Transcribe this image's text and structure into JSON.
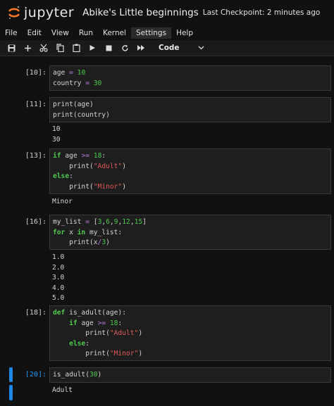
{
  "header": {
    "logo_text": "jupyter",
    "notebook_title": "Abike's Little beginnings",
    "checkpoint": "Last Checkpoint: 2 minutes ago"
  },
  "menu": [
    "File",
    "Edit",
    "View",
    "Run",
    "Kernel",
    "Settings",
    "Help"
  ],
  "toolbar": {
    "buttons": [
      "save-icon",
      "add-cell-icon",
      "cut-icon",
      "copy-icon",
      "paste-icon",
      "run-icon",
      "stop-icon",
      "restart-icon",
      "fast-forward-icon"
    ],
    "cell_type": "Code"
  },
  "cells": [
    {
      "prompt": "[10]:",
      "lines": [
        [
          [
            "age ",
            ""
          ],
          [
            "=",
            "op"
          ],
          [
            " ",
            ""
          ],
          [
            "10",
            "num"
          ]
        ],
        [
          [
            "country ",
            ""
          ],
          [
            "=",
            "op"
          ],
          [
            " ",
            ""
          ],
          [
            "30",
            "num"
          ]
        ]
      ],
      "output": []
    },
    {
      "prompt": "[11]:",
      "lines": [
        [
          [
            "print(age)",
            ""
          ]
        ],
        [
          [
            "print(country)",
            ""
          ]
        ]
      ],
      "output": [
        "10",
        "30"
      ]
    },
    {
      "prompt": "[13]:",
      "lines": [
        [
          [
            "if",
            "kw"
          ],
          [
            " age ",
            ""
          ],
          [
            ">=",
            "op"
          ],
          [
            " ",
            ""
          ],
          [
            "18",
            "num"
          ],
          [
            ":",
            ""
          ]
        ],
        [
          [
            "    print(",
            ""
          ],
          [
            "\"Adult\"",
            "str"
          ],
          [
            ")",
            ""
          ]
        ],
        [
          [
            "else",
            "kw"
          ],
          [
            ":",
            ""
          ]
        ],
        [
          [
            "    print(",
            ""
          ],
          [
            "\"Minor\"",
            "str"
          ],
          [
            ")",
            ""
          ]
        ]
      ],
      "output": [
        "Minor"
      ]
    },
    {
      "prompt": "[16]:",
      "lines": [
        [
          [
            "my_list ",
            ""
          ],
          [
            "=",
            "op"
          ],
          [
            " [",
            ""
          ],
          [
            "3",
            "num"
          ],
          [
            ",",
            ""
          ],
          [
            "6",
            "num"
          ],
          [
            ",",
            ""
          ],
          [
            "9",
            "num"
          ],
          [
            ",",
            ""
          ],
          [
            "12",
            "num"
          ],
          [
            ",",
            ""
          ],
          [
            "15",
            "num"
          ],
          [
            "]",
            ""
          ]
        ],
        [
          [
            "for",
            "kw"
          ],
          [
            " x ",
            ""
          ],
          [
            "in",
            "kw"
          ],
          [
            " my_list:",
            ""
          ]
        ],
        [
          [
            "    print(x",
            ""
          ],
          [
            "/",
            "op"
          ],
          [
            "3",
            "num"
          ],
          [
            ")",
            ""
          ]
        ]
      ],
      "output": [
        "1.0",
        "2.0",
        "3.0",
        "4.0",
        "5.0"
      ]
    },
    {
      "prompt": "[18]:",
      "lines": [
        [
          [
            "def",
            "kw"
          ],
          [
            " is_adult(age):",
            ""
          ]
        ],
        [
          [
            "    ",
            ""
          ],
          [
            "if",
            "kw"
          ],
          [
            " age ",
            ""
          ],
          [
            ">=",
            "op"
          ],
          [
            " ",
            ""
          ],
          [
            "18",
            "num"
          ],
          [
            ":",
            ""
          ]
        ],
        [
          [
            "        print(",
            ""
          ],
          [
            "\"Adult\"",
            "str"
          ],
          [
            ")",
            ""
          ]
        ],
        [
          [
            "    ",
            ""
          ],
          [
            "else",
            "kw"
          ],
          [
            ":",
            ""
          ]
        ],
        [
          [
            "        print(",
            ""
          ],
          [
            "\"Minor\"",
            "str"
          ],
          [
            ")",
            ""
          ]
        ]
      ],
      "output": []
    },
    {
      "prompt": "[20]:",
      "lines": [
        [
          [
            "is_adult(",
            ""
          ],
          [
            "30",
            "num"
          ],
          [
            ")",
            ""
          ]
        ]
      ],
      "output": [
        "Adult"
      ]
    }
  ]
}
